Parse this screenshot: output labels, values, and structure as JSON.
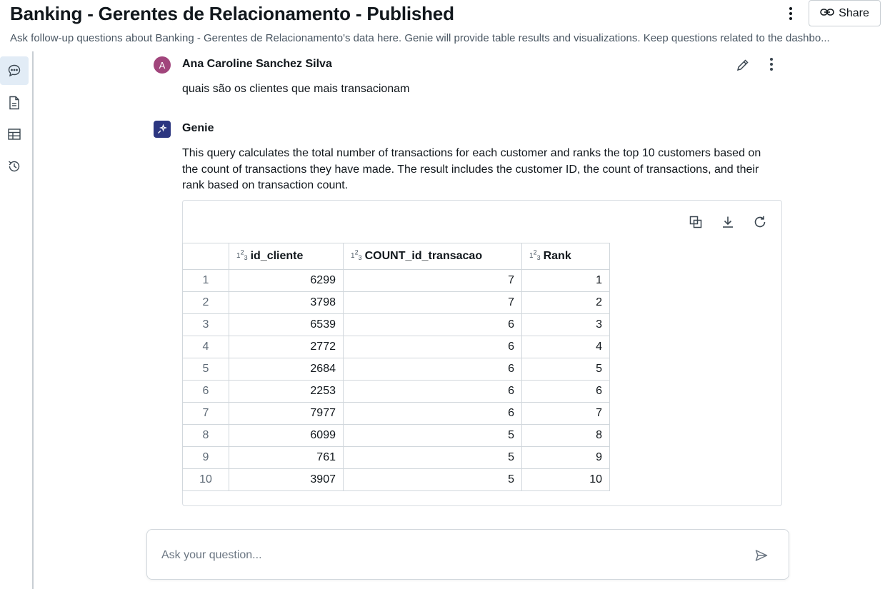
{
  "header": {
    "title": "Banking - Gerentes de Relacionamento - Published",
    "subtitle": "Ask follow-up questions about Banking - Gerentes de Relacionamento's data here. Genie will provide table results and visualizations. Keep questions related to the dashbo...",
    "share_label": "Share"
  },
  "user_message": {
    "avatar_initial": "A",
    "author": "Ana Caroline Sanchez Silva",
    "text": "quais são os clientes que mais transacionam"
  },
  "genie": {
    "name": "Genie",
    "description": "This query calculates the total number of transactions for each customer and ranks the top 10 customers based on the count of transactions they have made. The result includes the customer ID, the count of transactions, and their rank based on transaction count."
  },
  "table": {
    "columns": [
      "id_cliente",
      "COUNT_id_transacao",
      "Rank"
    ],
    "rows": [
      {
        "idx": "1",
        "id_cliente": "6299",
        "count": "7",
        "rank": "1"
      },
      {
        "idx": "2",
        "id_cliente": "3798",
        "count": "7",
        "rank": "2"
      },
      {
        "idx": "3",
        "id_cliente": "6539",
        "count": "6",
        "rank": "3"
      },
      {
        "idx": "4",
        "id_cliente": "2772",
        "count": "6",
        "rank": "4"
      },
      {
        "idx": "5",
        "id_cliente": "2684",
        "count": "6",
        "rank": "5"
      },
      {
        "idx": "6",
        "id_cliente": "2253",
        "count": "6",
        "rank": "6"
      },
      {
        "idx": "7",
        "id_cliente": "7977",
        "count": "6",
        "rank": "7"
      },
      {
        "idx": "8",
        "id_cliente": "6099",
        "count": "5",
        "rank": "8"
      },
      {
        "idx": "9",
        "id_cliente": "761",
        "count": "5",
        "rank": "9"
      },
      {
        "idx": "10",
        "id_cliente": "3907",
        "count": "5",
        "rank": "10"
      }
    ]
  },
  "input": {
    "placeholder": "Ask your question..."
  },
  "icons": {
    "rail": [
      "chat-icon",
      "document-icon",
      "table-icon",
      "history-icon"
    ],
    "card_actions": [
      "copy-icon",
      "download-icon",
      "refresh-icon"
    ]
  },
  "colors": {
    "user_avatar": "#a1457c",
    "genie_avatar": "#2c3680",
    "rail_active": "#e2ecf6"
  }
}
